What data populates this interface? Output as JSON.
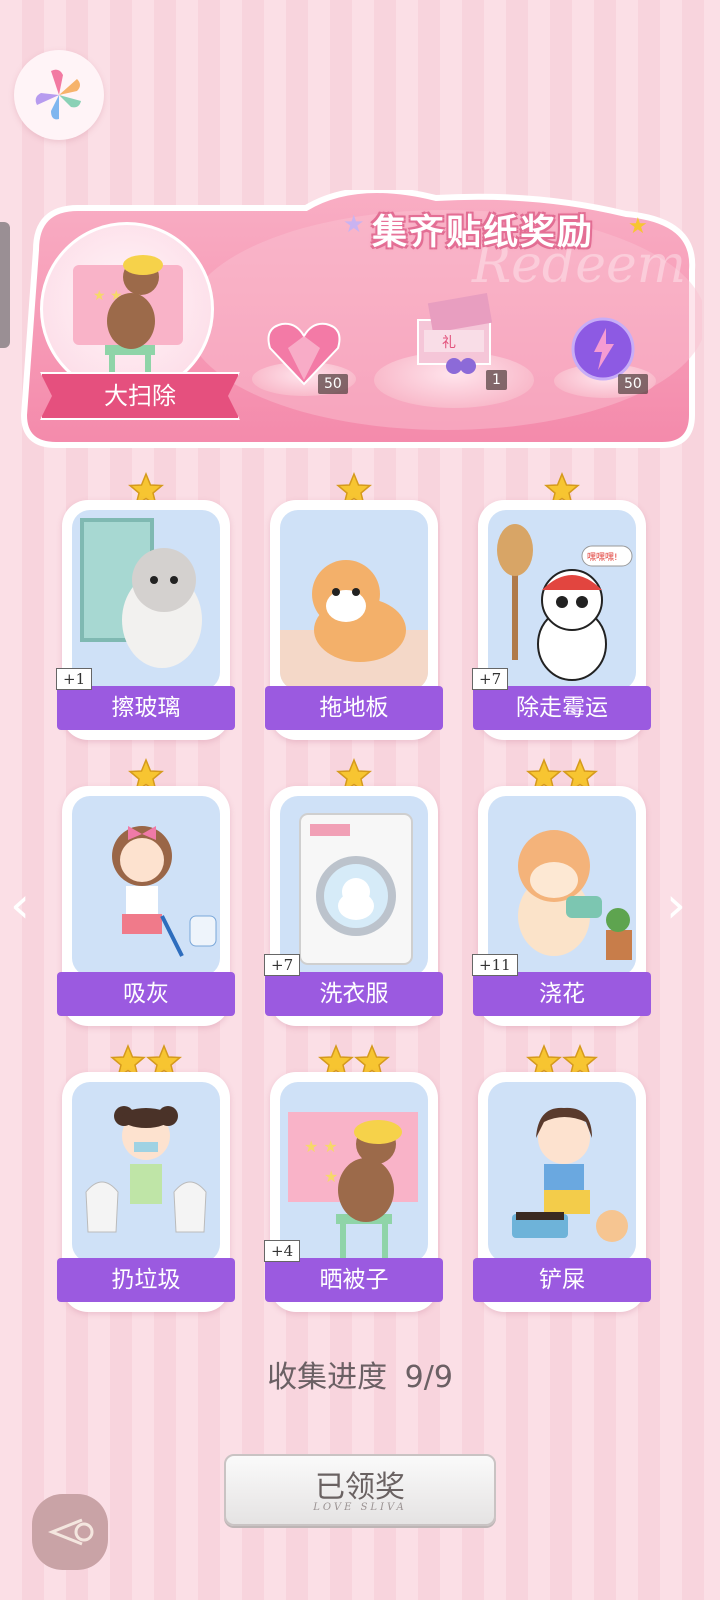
{
  "banner": {
    "title": "集齐贴纸奖励",
    "watermark": "Redeem",
    "feature_label": "大扫除",
    "rewards": [
      {
        "icon": "pink-diamond-heart-icon",
        "qty": "50"
      },
      {
        "icon": "gift-box-icon",
        "qty": "1"
      },
      {
        "icon": "purple-energy-orb-icon",
        "qty": "50"
      }
    ]
  },
  "stickers": [
    {
      "label": "擦玻璃",
      "stars": 1,
      "badge": "+1",
      "icon": "cat-cleaning-window-icon"
    },
    {
      "label": "拖地板",
      "stars": 1,
      "badge": "",
      "icon": "corgi-mopping-icon"
    },
    {
      "label": "除走霉运",
      "stars": 1,
      "badge": "+7",
      "icon": "panda-with-broom-icon",
      "bubble": "嘿嘿嘿!"
    },
    {
      "label": "吸灰",
      "stars": 1,
      "badge": "",
      "icon": "girl-vacuuming-icon"
    },
    {
      "label": "洗衣服",
      "stars": 1,
      "badge": "+7",
      "icon": "cat-in-washing-machine-icon"
    },
    {
      "label": "浇花",
      "stars": 2,
      "badge": "+11",
      "icon": "cat-watering-plant-icon"
    },
    {
      "label": "扔垃圾",
      "stars": 2,
      "badge": "",
      "icon": "girl-carrying-trash-icon"
    },
    {
      "label": "晒被子",
      "stars": 2,
      "badge": "+4",
      "icon": "bear-hanging-quilt-icon"
    },
    {
      "label": "铲屎",
      "stars": 2,
      "badge": "",
      "icon": "girl-cleaning-litter-icon"
    }
  ],
  "progress": {
    "label": "收集进度",
    "value": "9/9"
  },
  "claim_button": {
    "label": "已领奖",
    "sub": "LOVE SLIVA"
  },
  "colors": {
    "accent": "#9b5ae0",
    "banner_pink": "#f28cab",
    "star": "#f7c531"
  }
}
